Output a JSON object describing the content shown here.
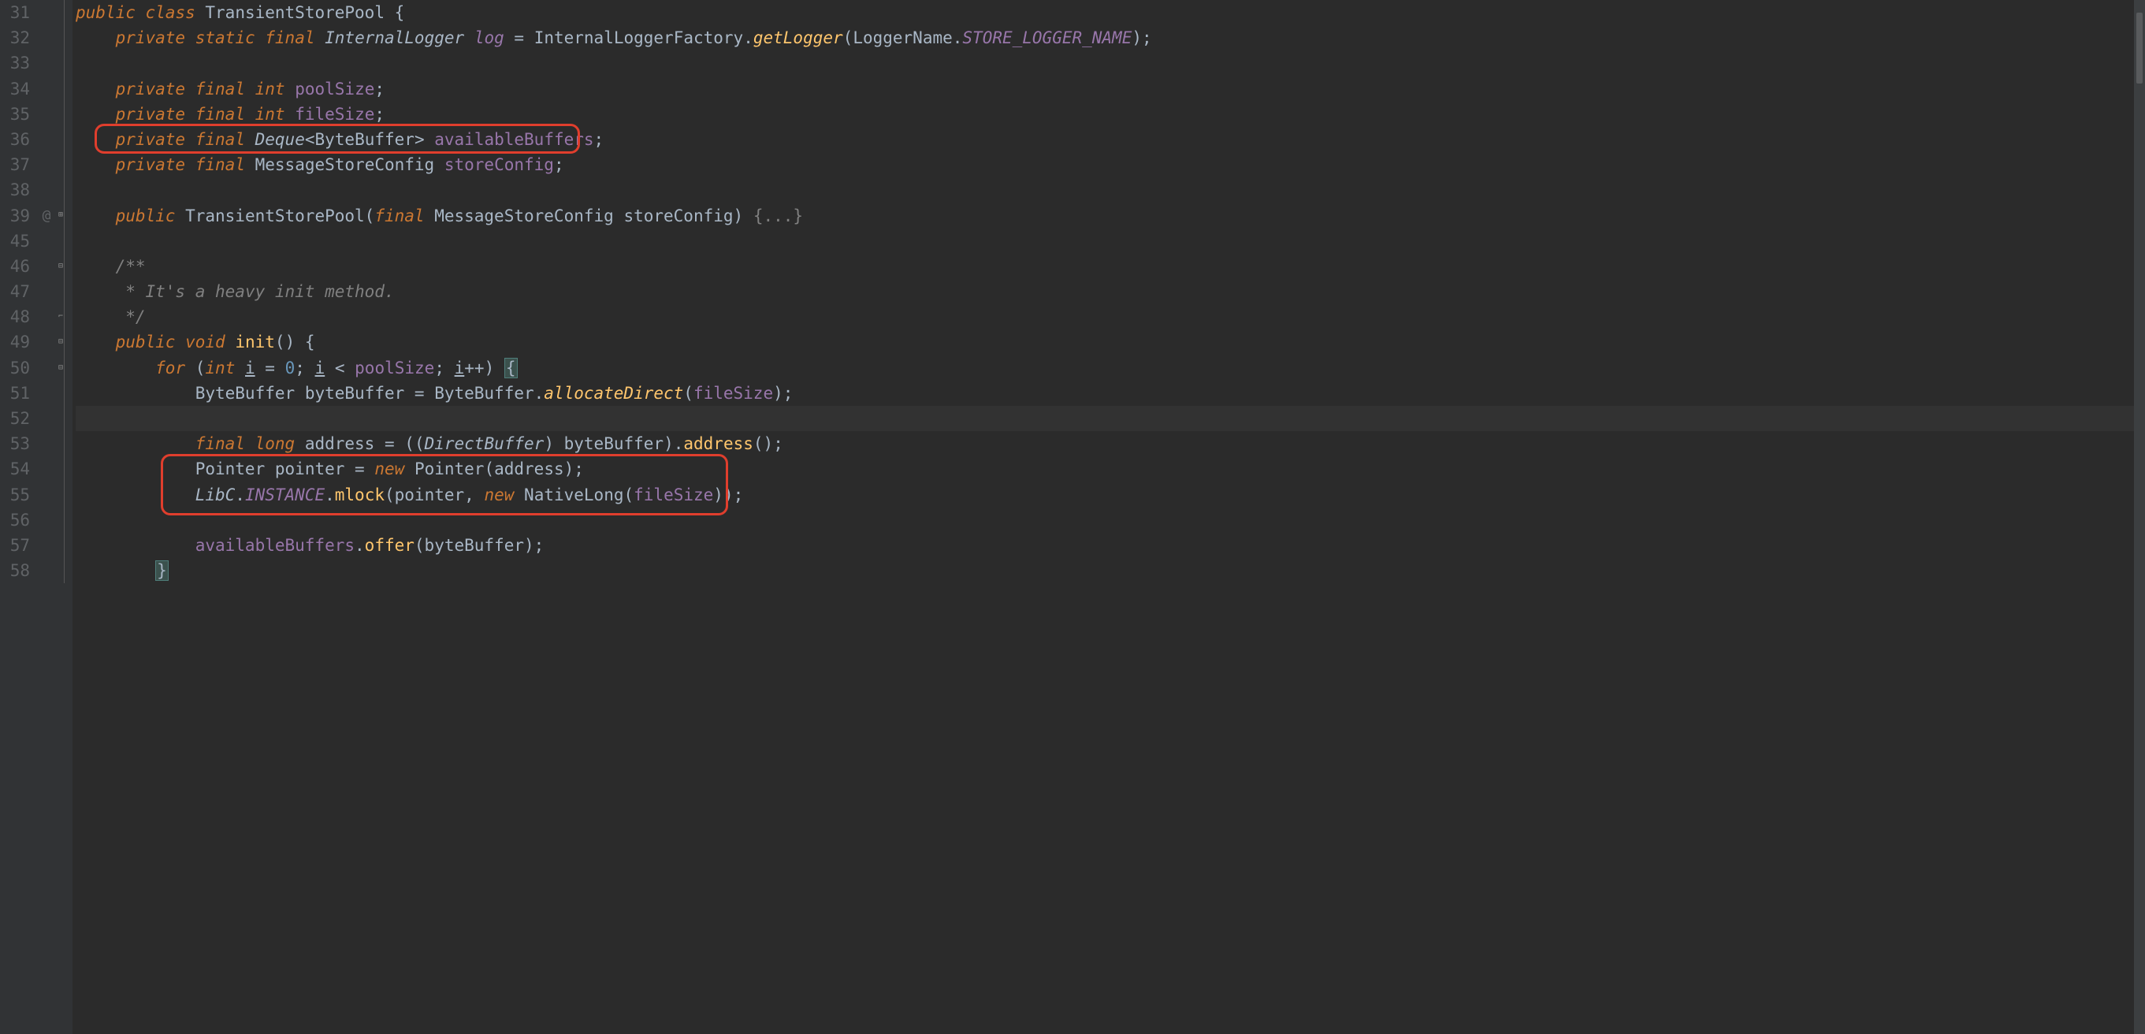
{
  "lines": {
    "31": "31",
    "32": "32",
    "33": "33",
    "34": "34",
    "35": "35",
    "36": "36",
    "37": "37",
    "38": "38",
    "39": "39",
    "45": "45",
    "46": "46",
    "47": "47",
    "48": "48",
    "49": "49",
    "50": "50",
    "51": "51",
    "52": "52",
    "53": "53",
    "54": "54",
    "55": "55",
    "56": "56",
    "57": "57",
    "58": "58"
  },
  "anno": {
    "at": "@"
  },
  "tokens": {
    "public": "public",
    "class": "class",
    "private": "private",
    "static": "static",
    "final": "final",
    "int": "int",
    "void": "void",
    "for": "for",
    "new": "new",
    "long": "long",
    "lbrace": " {",
    "rbrace": "}",
    "semi": ";",
    "lparen": "(",
    "rparen": ")",
    "lt": "<",
    "gt": ">",
    "eq": " = ",
    "comma": ", ",
    "dot": ".",
    "dots": "{...}",
    "lsb": "[",
    "rsb": "]",
    "lbrace2": "{",
    "doubleparen": "))",
    "sp1": " ",
    "sp2": "    ",
    "sp3": "        ",
    "sp4": "            ",
    "sp5": "                "
  },
  "c": {
    "className": "TransientStorePool",
    "logType": "InternalLogger",
    "logVar": "log",
    "logFactory": "InternalLoggerFactory",
    "getLogger": "getLogger",
    "loggerName": "LoggerName",
    "storeLoggerName": "STORE_LOGGER_NAME",
    "poolSize": "poolSize",
    "fileSize": "fileSize",
    "deque": "Deque",
    "byteBuffer": "ByteBuffer",
    "availableBuffers": "availableBuffers",
    "msConfig": "MessageStoreConfig",
    "storeConfig": "storeConfig",
    "commentStart": "/**",
    "commentBody": " * It's a heavy init method.",
    "commentEnd": " */",
    "init": "init",
    "i": "i",
    "zero": "0",
    "ltOp": " < ",
    "inc": "++",
    "byteBufferVar": "byteBuffer",
    "allocateDirect": "allocateDirect",
    "address": "address",
    "directBuffer": "DirectBuffer",
    "pointerType": "Pointer",
    "pointer": "pointer",
    "libc": "LibC",
    "instance": "INSTANCE",
    "mlock": "mlock",
    "nativeLong": "NativeLong",
    "offer": "offer"
  }
}
